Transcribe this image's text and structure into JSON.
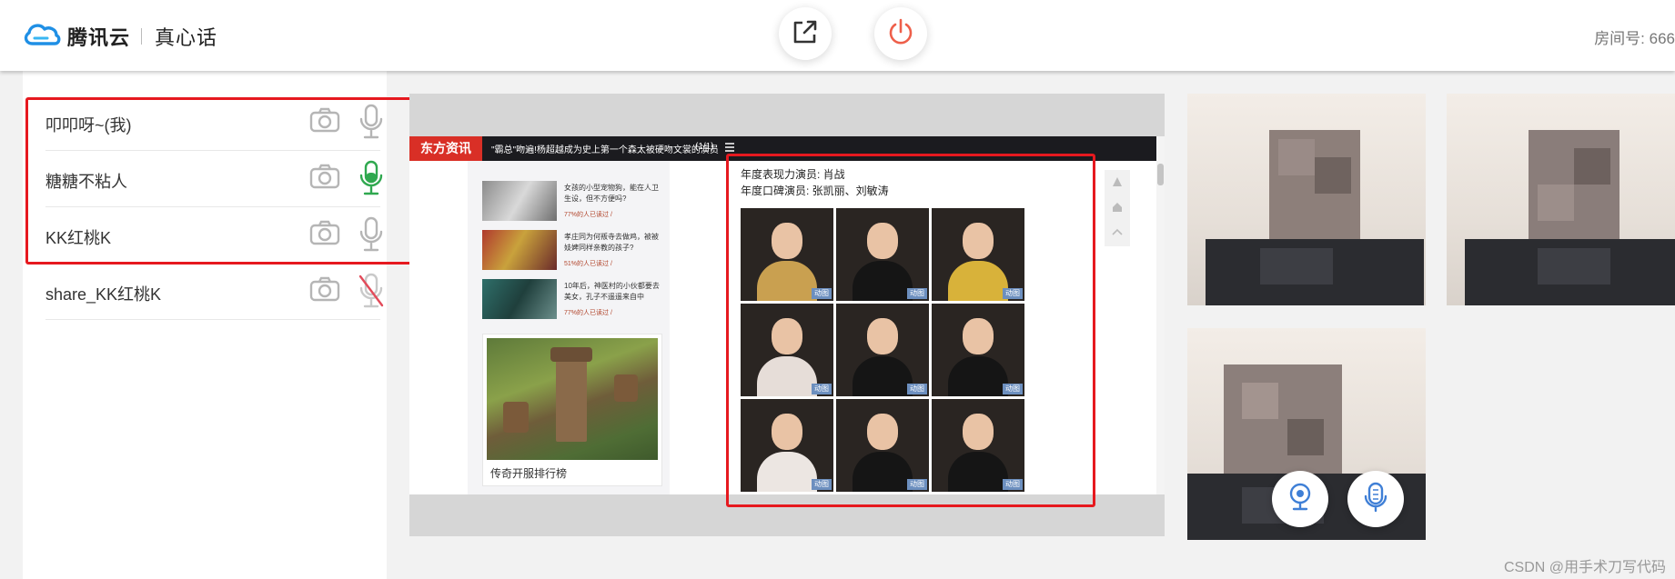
{
  "header": {
    "brand": "腾讯云",
    "app_name": "真心话",
    "share_screen_button": "share-screen-icon",
    "exit_button": "power-icon",
    "room_label": "房间号: 666"
  },
  "colors": {
    "accent_red": "#e6191f",
    "mic_active": "#2fa84f",
    "mic_muted": "#e24b5a",
    "mic_blue": "#3f7fd6",
    "exit_orange": "#ee5f4a"
  },
  "members": [
    {
      "name": "叩叩呀~(我)",
      "camera": "camera-icon",
      "mic": "normal"
    },
    {
      "name": "糖糖不粘人",
      "camera": "camera-icon",
      "mic": "active"
    },
    {
      "name": "KK红桃K",
      "camera": "camera-icon",
      "mic": "normal"
    },
    {
      "name": "share_KK红桃K",
      "camera": "camera-icon",
      "mic": "muted"
    }
  ],
  "share": {
    "brand": "东方资讯",
    "headline": "\"霸总\"吻遍!杨超越成为史上第一个森太被硬吻文裳的演员",
    "page": "(1/1)",
    "feed": [
      {
        "title": "女孩的小型宠物狗，能在人卫生设，但不方便吗?",
        "meta": "77%的人已读过 /"
      },
      {
        "title": "孝庄同为何叛寺去做鸡，被被妓婢同样亲教的孩子?",
        "meta": "51%的人已读过 /"
      },
      {
        "title": "10年后，神医村的小伙都要去美女，孔子不遥遥来自中",
        "meta": "77%的人已读过 /"
      }
    ],
    "promo_caption": "传奇开服排行榜",
    "article_lines": [
      "年度表现力演员: 肖战",
      "年度口碑演员: 张凯丽、刘敏涛"
    ],
    "photo_tag": "动图"
  },
  "video_tiles": {
    "mic_icon": "mic-icon",
    "webcam_icon": "webcam-icon"
  },
  "watermark": "CSDN @用手术刀写代码"
}
